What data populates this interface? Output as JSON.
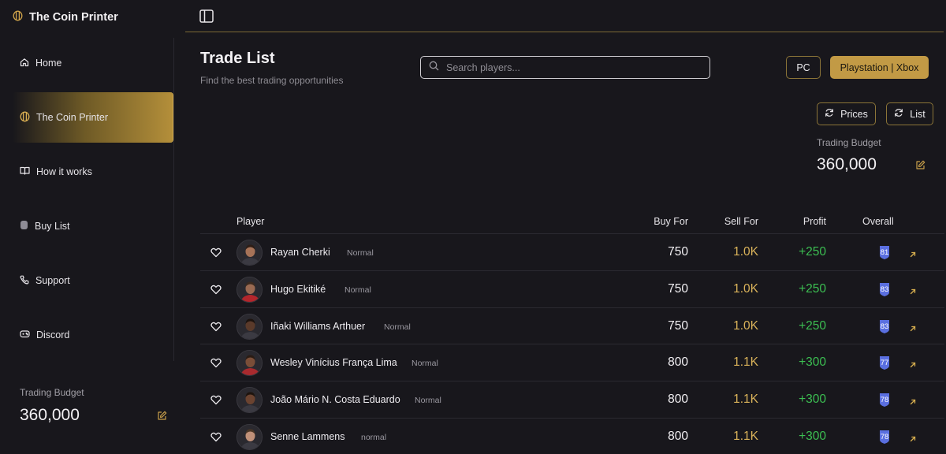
{
  "brand": {
    "name": "The Coin Printer"
  },
  "sidebar": {
    "items": [
      {
        "label": "Home",
        "icon": "home-icon",
        "active": false
      },
      {
        "label": "The Coin Printer",
        "icon": "coin-icon",
        "active": true
      },
      {
        "label": "How it works",
        "icon": "book-icon",
        "active": false
      },
      {
        "label": "Buy List",
        "icon": "coin-stack-icon",
        "active": false
      },
      {
        "label": "Support",
        "icon": "phone-icon",
        "active": false
      },
      {
        "label": "Discord",
        "icon": "gamepad-icon",
        "active": false
      }
    ],
    "budget_label": "Trading Budget",
    "budget_value": "360,000"
  },
  "header": {
    "title": "Trade List",
    "subtitle": "Find the best trading opportunities"
  },
  "search": {
    "placeholder": "Search players...",
    "value": ""
  },
  "platforms": {
    "pc_label": "PC",
    "console_label": "Playstation | Xbox",
    "selected": "Playstation | Xbox"
  },
  "actions": {
    "prices_label": "Prices",
    "list_label": "List"
  },
  "budget": {
    "label": "Trading Budget",
    "value": "360,000"
  },
  "table": {
    "headers": {
      "player": "Player",
      "buy": "Buy For",
      "sell": "Sell For",
      "profit": "Profit",
      "overall": "Overall"
    },
    "rows": [
      {
        "name": "Rayan Cherki",
        "tag": "Normal",
        "buy": "750",
        "sell": "1.0K",
        "profit": "+250",
        "overall": "81"
      },
      {
        "name": "Hugo Ekitiké",
        "tag": "Normal",
        "buy": "750",
        "sell": "1.0K",
        "profit": "+250",
        "overall": "83"
      },
      {
        "name": "Iñaki Williams Arthuer",
        "tag": "Normal",
        "buy": "750",
        "sell": "1.0K",
        "profit": "+250",
        "overall": "83"
      },
      {
        "name": "Wesley Vinícius França Lima",
        "tag": "Normal",
        "buy": "800",
        "sell": "1.1K",
        "profit": "+300",
        "overall": "77"
      },
      {
        "name": "João Mário N. Costa Eduardo",
        "tag": "Normal",
        "buy": "800",
        "sell": "1.1K",
        "profit": "+300",
        "overall": "78"
      },
      {
        "name": "Senne Lammens",
        "tag": "normal",
        "buy": "800",
        "sell": "1.1K",
        "profit": "+300",
        "overall": "78"
      }
    ]
  },
  "colors": {
    "accent_gold": "#c29a45",
    "sell_gold": "#d9b25a",
    "profit_green": "#3cbf52",
    "overall_badge": "#5a6fe0",
    "background": "#18171c"
  }
}
